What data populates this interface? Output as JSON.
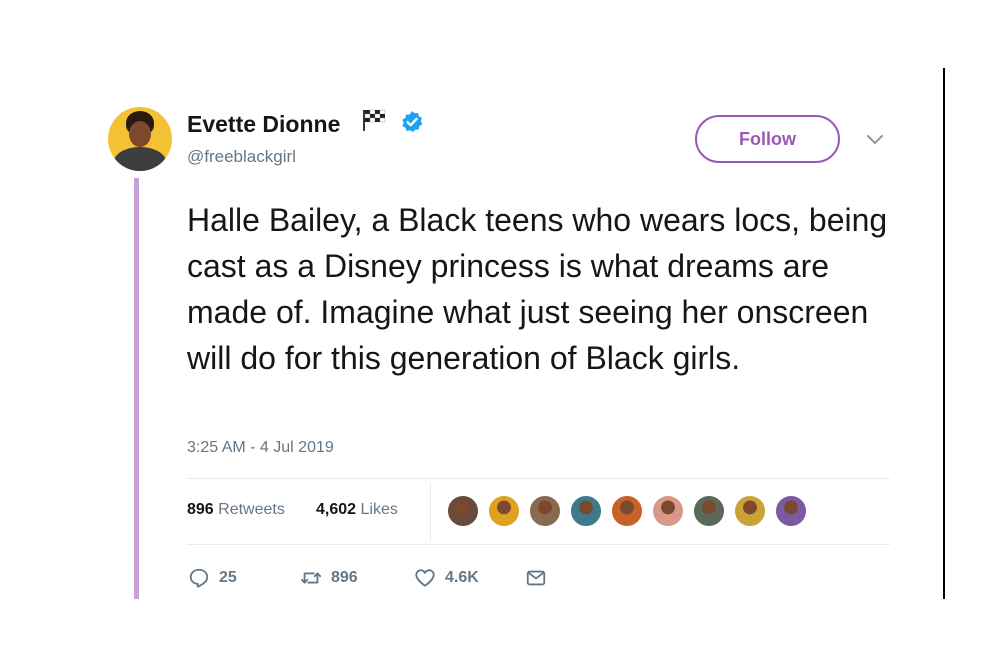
{
  "tweet": {
    "author_name": "Evette Dionne",
    "handle": "@freeblackgirl",
    "follow_label": "Follow",
    "text": "Halle Bailey, a Black teens who wears locs, being cast as a Disney princess is what dreams are made of. Imagine what just seeing her onscreen will do for this generation of Black girls.",
    "timestamp": "3:25 AM - 4 Jul 2019"
  },
  "stats": {
    "retweets_count": "896",
    "retweets_label": "Retweets",
    "likes_count": "4,602",
    "likes_label": "Likes"
  },
  "likers": [
    {
      "name": "liker-avatar-1",
      "color": "#6b4a3a"
    },
    {
      "name": "liker-avatar-2",
      "color": "#e0a020"
    },
    {
      "name": "liker-avatar-3",
      "color": "#8a6a4e"
    },
    {
      "name": "liker-avatar-4",
      "color": "#3d7a8a"
    },
    {
      "name": "liker-avatar-5",
      "color": "#c8602a"
    },
    {
      "name": "liker-avatar-6",
      "color": "#d79a8a"
    },
    {
      "name": "liker-avatar-7",
      "color": "#5a6a5a"
    },
    {
      "name": "liker-avatar-8",
      "color": "#c9a23a"
    },
    {
      "name": "liker-avatar-9",
      "color": "#7a5aa0"
    }
  ],
  "actions": {
    "reply_count": "25",
    "retweet_count": "896",
    "like_count": "4.6K"
  },
  "colors": {
    "accent": "#9b59b6",
    "thread_line": "#c9a0dc",
    "verified": "#1da1f2",
    "muted": "#657786"
  },
  "icons": [
    "flag-icon",
    "verified-icon",
    "chevron-down-icon",
    "reply-icon",
    "retweet-icon",
    "like-icon",
    "message-icon"
  ]
}
